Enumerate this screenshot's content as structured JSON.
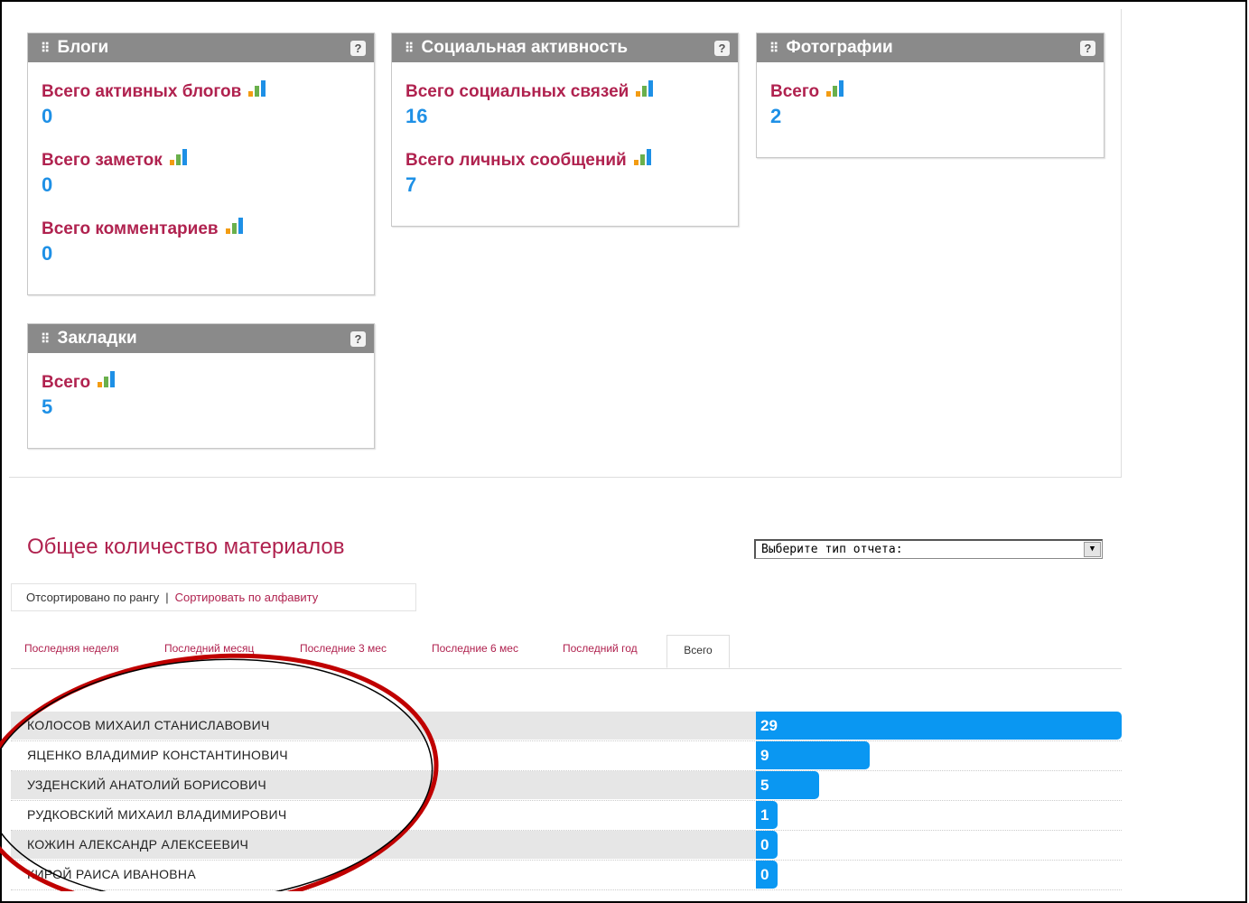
{
  "widgets": {
    "blogs": {
      "title": "Блоги",
      "help": "?",
      "stats": [
        {
          "label": "Всего активных блогов",
          "value": "0"
        },
        {
          "label": "Всего заметок",
          "value": "0"
        },
        {
          "label": "Всего комментариев",
          "value": "0"
        }
      ]
    },
    "social": {
      "title": "Социальная активность",
      "help": "?",
      "stats": [
        {
          "label": "Всего социальных связей",
          "value": "16"
        },
        {
          "label": "Всего личных сообщений",
          "value": "7"
        }
      ]
    },
    "photos": {
      "title": "Фотографии",
      "help": "?",
      "stats": [
        {
          "label": "Всего",
          "value": "2"
        }
      ]
    },
    "bookmarks": {
      "title": "Закладки",
      "help": "?",
      "stats": [
        {
          "label": "Всего",
          "value": "5"
        }
      ]
    }
  },
  "grip_glyph": "⠿",
  "section": {
    "title": "Общее количество материалов",
    "report_select": "Выберите тип отчета:"
  },
  "sort": {
    "current": "Отсортировано по рангу",
    "separator": "|",
    "alt_link": "Сортировать по алфавиту"
  },
  "tabs": [
    {
      "label": "Последняя неделя"
    },
    {
      "label": "Последний месяц"
    },
    {
      "label": "Последние 3 мес"
    },
    {
      "label": "Последние 6 мес"
    },
    {
      "label": "Последний год"
    },
    {
      "label": "Всего",
      "active": true
    }
  ],
  "ranking": {
    "max": 29,
    "rows": [
      {
        "name": "КОЛОСОВ МИХАИЛ СТАНИСЛАВОВИЧ",
        "value": 29
      },
      {
        "name": "ЯЦЕНКО ВЛАДИМИР КОНСТАНТИНОВИЧ",
        "value": 9
      },
      {
        "name": "УЗДЕНСКИЙ АНАТОЛИЙ БОРИСОВИЧ",
        "value": 5
      },
      {
        "name": "РУДКОВСКИЙ МИХАИЛ ВЛАДИМИРОВИЧ",
        "value": 1
      },
      {
        "name": "КОЖИН АЛЕКСАНДР АЛЕКСЕЕВИЧ",
        "value": 0
      },
      {
        "name": "КИРОЙ РАИСА ИВАНОВНА",
        "value": 0
      }
    ]
  },
  "colors": {
    "accent": "#b0224f",
    "value": "#1e90e6",
    "bar": "#0a97f2",
    "annotation": "#c00000"
  }
}
